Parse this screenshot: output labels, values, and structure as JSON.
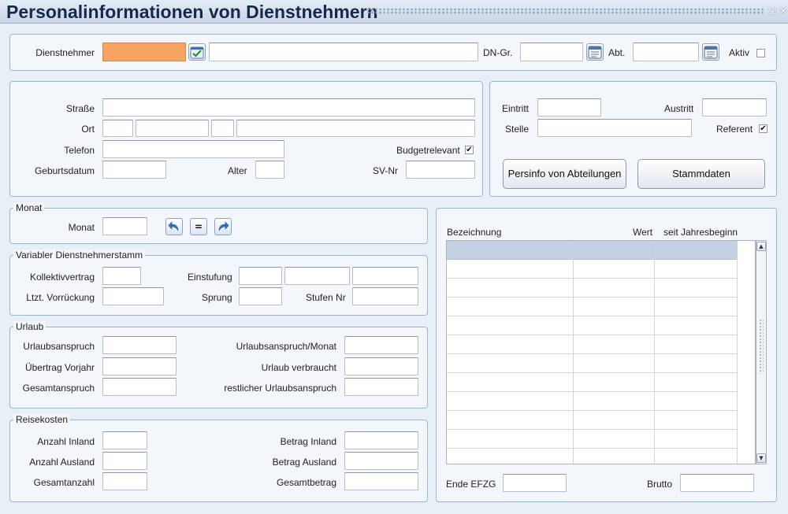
{
  "window": {
    "title": "Personalinformationen von Dienstnehmern",
    "min_glyph": "⇲",
    "close_glyph": "✕"
  },
  "header": {
    "dienstnehmer_label": "Dienstnehmer",
    "dienstnehmer_value": "",
    "name_value": "",
    "dngr_label": "DN-Gr.",
    "dngr_value": "",
    "abt_label": "Abt.",
    "abt_value": "",
    "aktiv_label": "Aktiv",
    "aktiv_checked": false
  },
  "address": {
    "strasse_label": "Straße",
    "ort_label": "Ort",
    "telefon_label": "Telefon",
    "budget_label": "Budgetrelevant",
    "budget_checked": true,
    "geburtsdatum_label": "Geburtsdatum",
    "alter_label": "Alter",
    "svnr_label": "SV-Nr"
  },
  "employment": {
    "eintritt_label": "Eintritt",
    "austritt_label": "Austritt",
    "stelle_label": "Stelle",
    "referent_label": "Referent",
    "referent_checked": true,
    "persinfo_button": "Persinfo von Abteilungen",
    "stammdaten_button": "Stammdaten"
  },
  "monat": {
    "legend": "Monat",
    "monat_label": "Monat",
    "eq_label": "="
  },
  "variabler": {
    "legend": "Variabler Dienstnehmerstamm",
    "kollektivvertrag_label": "Kollektivvertrag",
    "einstufung_label": "Einstufung",
    "vorrueckung_label": "Ltzt. Vorrückung",
    "sprung_label": "Sprung",
    "stufen_label": "Stufen Nr"
  },
  "urlaub": {
    "legend": "Urlaub",
    "anspruch_label": "Urlaubsanspruch",
    "uebertrag_label": "Übertrag Vorjahr",
    "gesamtanspruch_label": "Gesamtanspruch",
    "anspruch_monat_label": "Urlaubsanspruch/Monat",
    "verbraucht_label": "Urlaub verbraucht",
    "restlich_label": "restlicher Urlaubsanspruch"
  },
  "reisekosten": {
    "legend": "Reisekosten",
    "anzahl_inland_label": "Anzahl Inland",
    "anzahl_ausland_label": "Anzahl Ausland",
    "gesamtanzahl_label": "Gesamtanzahl",
    "betrag_inland_label": "Betrag Inland",
    "betrag_ausland_label": "Betrag Ausland",
    "gesamtbetrag_label": "Gesamtbetrag"
  },
  "table": {
    "columns": [
      "Bezeichnung",
      "Wert",
      "seit Jahresbeginn"
    ],
    "ende_efzg_label": "Ende EFZG",
    "brutto_label": "Brutto"
  },
  "icons": {
    "check_icon": "check-icon",
    "calendar_icon": "list-picker-icon",
    "arrow_back": "arrow-back-icon",
    "arrow_forward": "arrow-forward-icon"
  }
}
